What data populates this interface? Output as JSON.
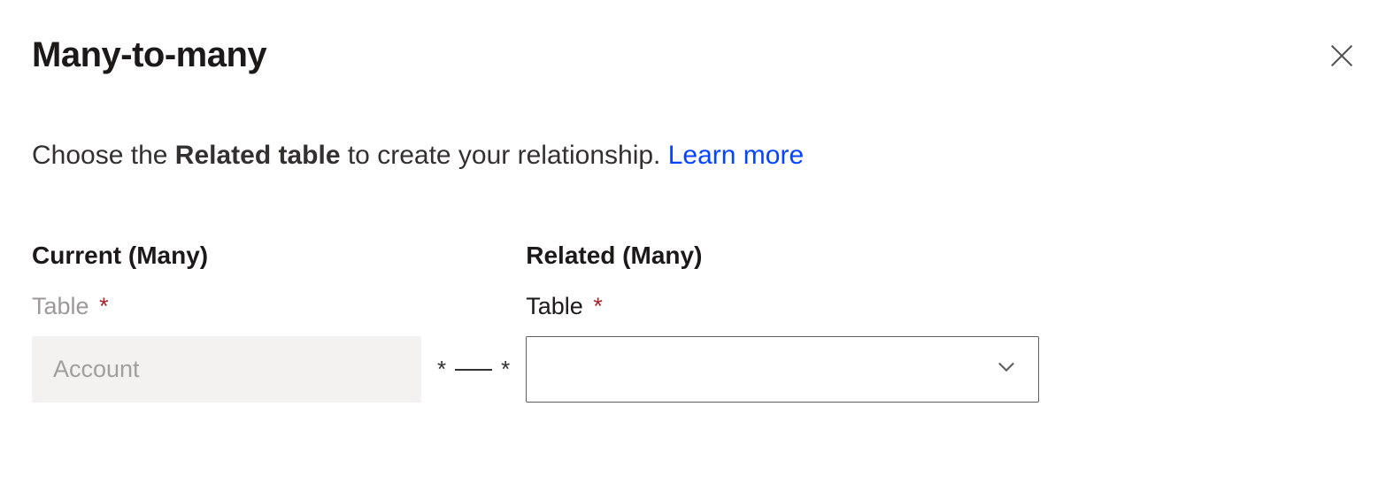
{
  "header": {
    "title": "Many-to-many"
  },
  "intro": {
    "prefix": "Choose the ",
    "bold": "Related table",
    "suffix": " to create your relationship. ",
    "link_text": "Learn more"
  },
  "current": {
    "heading": "Current (Many)",
    "field_label": "Table",
    "required_mark": "*",
    "value": "Account"
  },
  "connector": {
    "left": "*",
    "right": "*"
  },
  "related": {
    "heading": "Related (Many)",
    "field_label": "Table",
    "required_mark": "*",
    "value": ""
  }
}
